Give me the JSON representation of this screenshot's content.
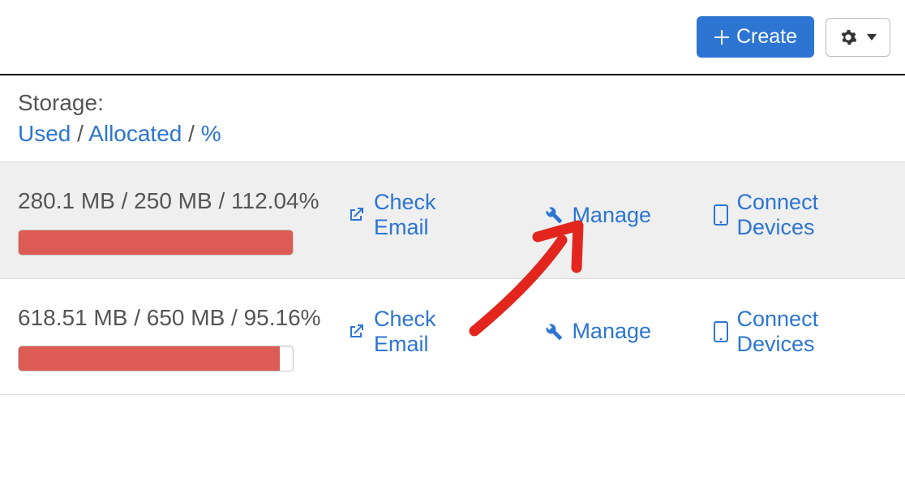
{
  "toolbar": {
    "create_label": "Create"
  },
  "header": {
    "title": "Storage:",
    "used_label": "Used",
    "allocated_label": "Allocated",
    "percent_label": "%"
  },
  "actions": {
    "check_email": "Check Email",
    "manage": "Manage",
    "connect_devices": "Connect Devices"
  },
  "rows": [
    {
      "used": "280.1 MB",
      "allocated": "250 MB",
      "percent": "112.04%",
      "bar_pct": 100
    },
    {
      "used": "618.51 MB",
      "allocated": "650 MB",
      "percent": "95.16%",
      "bar_pct": 95.16
    }
  ],
  "colors": {
    "primary": "#2c75d3",
    "danger": "#dc5b54"
  }
}
